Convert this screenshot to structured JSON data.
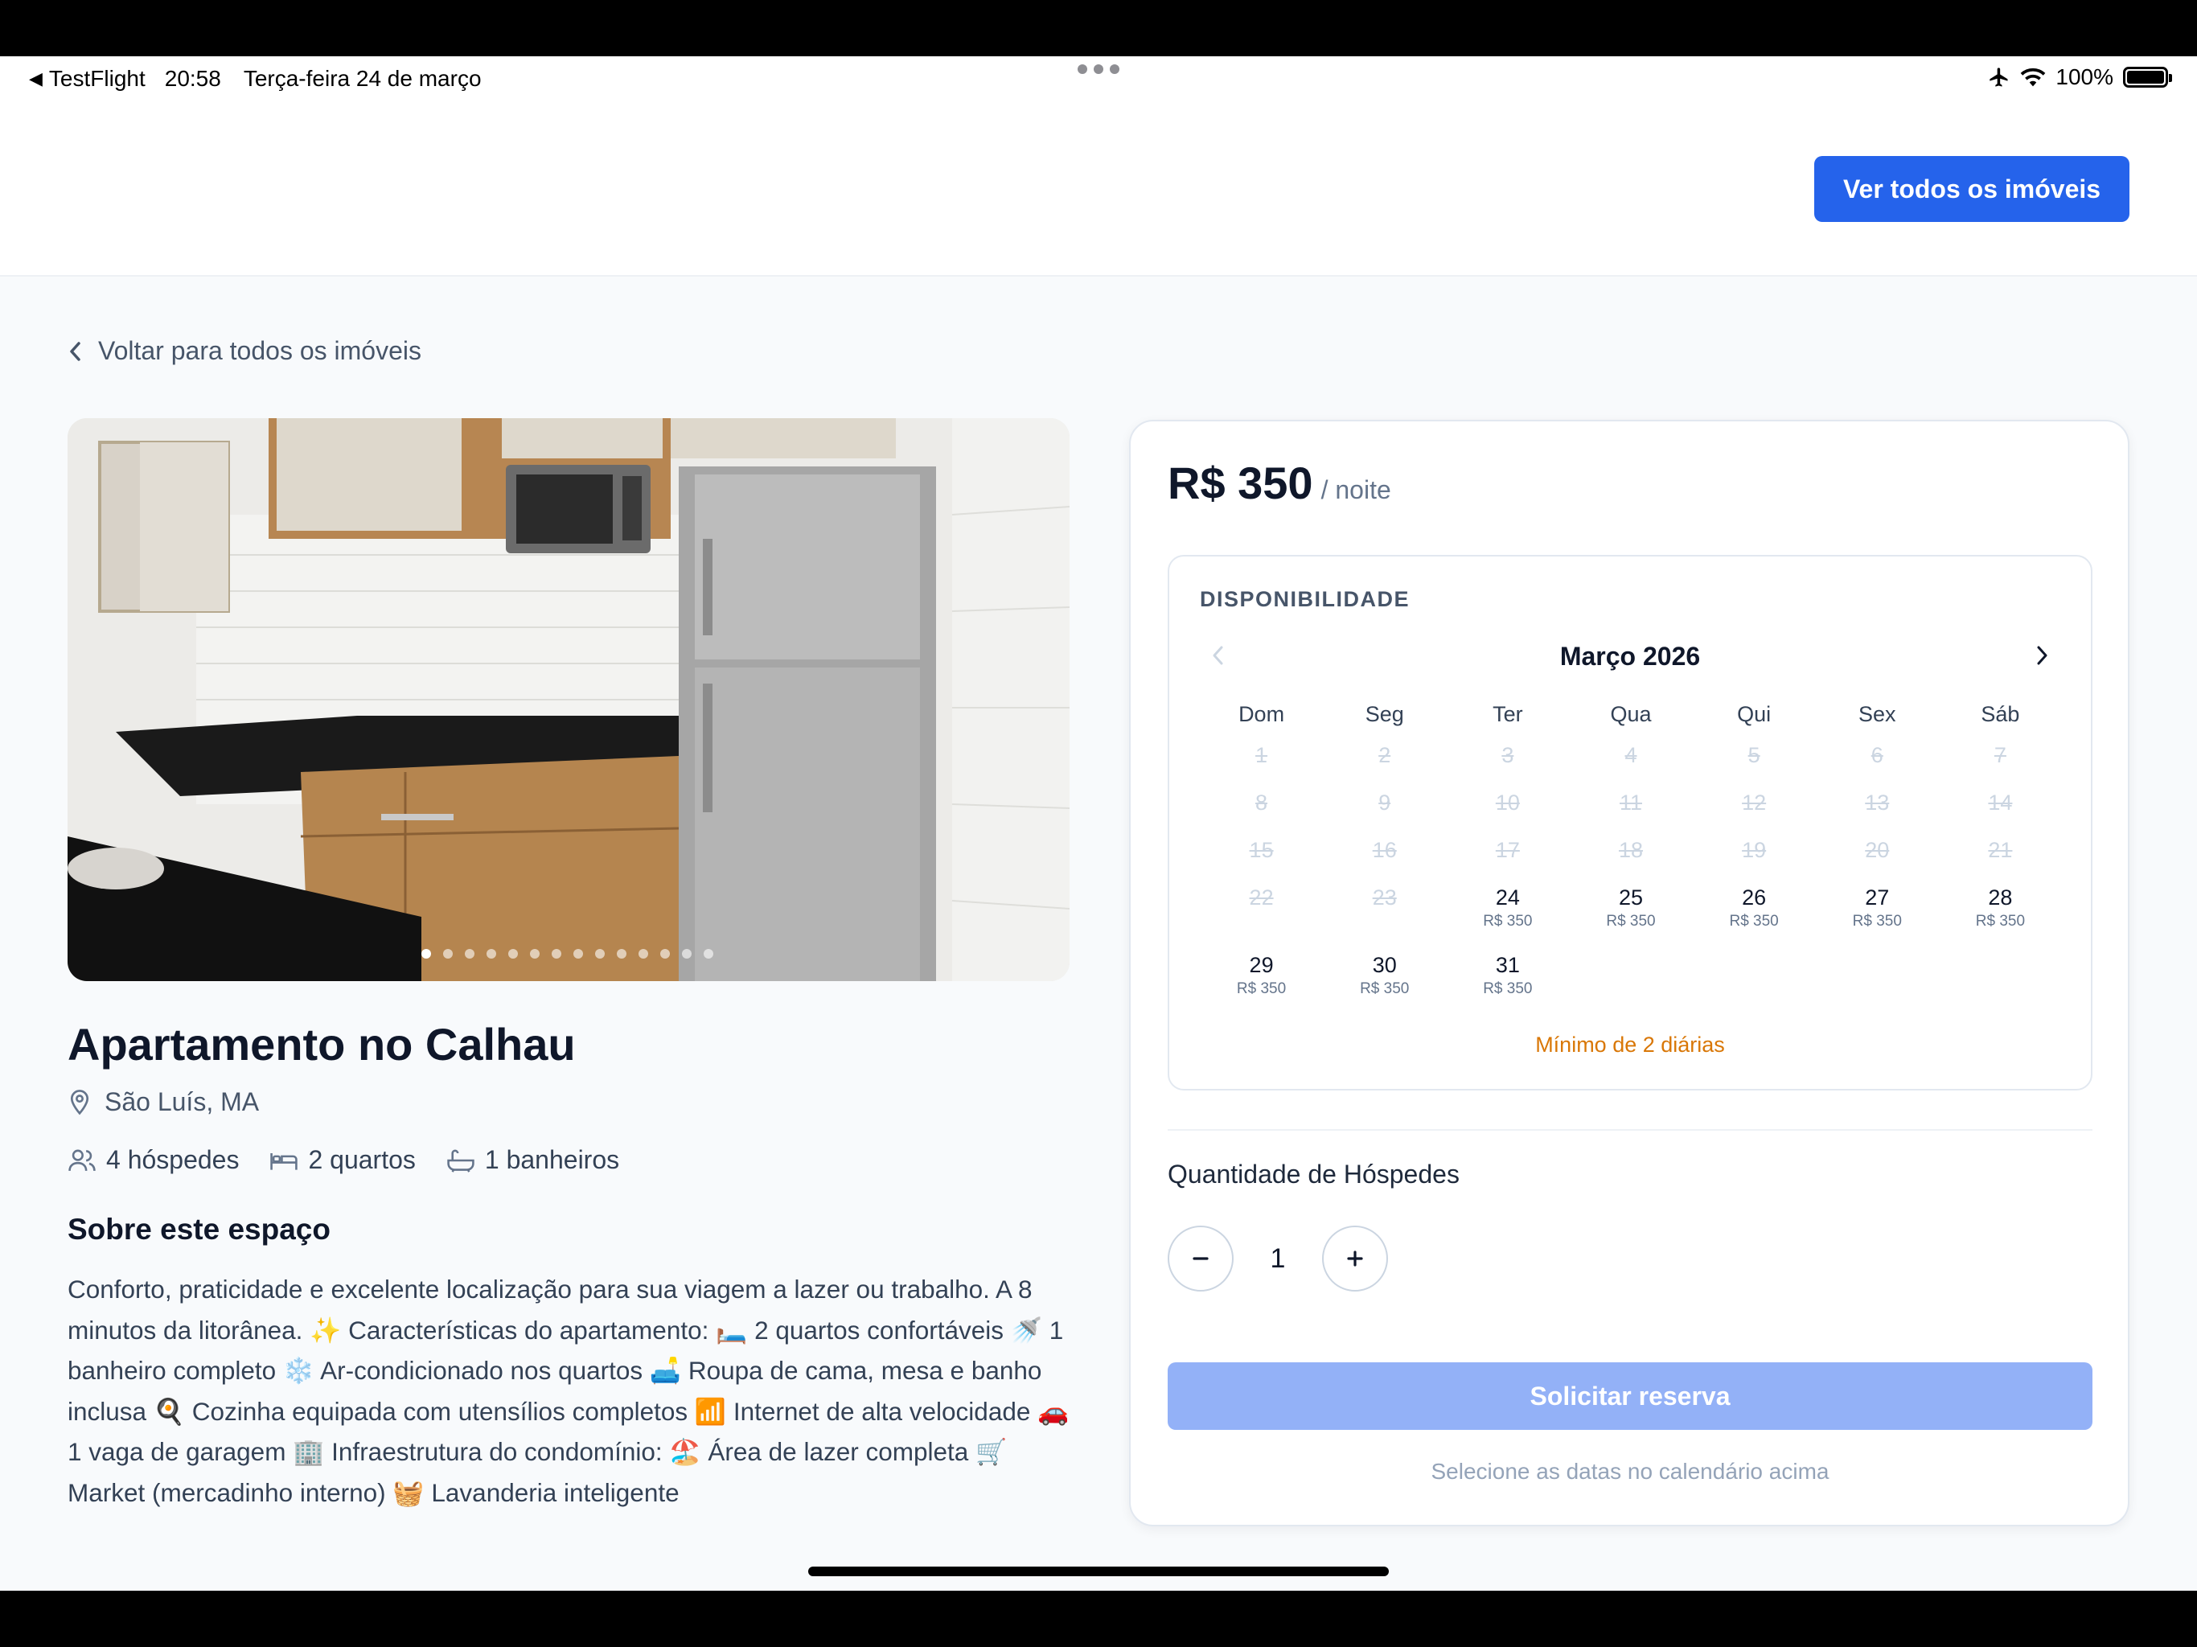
{
  "status_bar": {
    "back_app": "TestFlight",
    "time": "20:58",
    "date": "Terça-feira 24 de março",
    "battery": "100%"
  },
  "header": {
    "view_all_button": "Ver todos os imóveis"
  },
  "back_link": "Voltar para todos os imóveis",
  "gallery": {
    "photo_count": 14,
    "active_index": 0
  },
  "property": {
    "title": "Apartamento no Calhau",
    "location": "São Luís, MA",
    "guests": "4 hóspedes",
    "bedrooms": "2 quartos",
    "bathrooms": "1 banheiros",
    "about_title": "Sobre este espaço",
    "about_text": "Conforto, praticidade e excelente localização para sua viagem a lazer ou trabalho. A 8 minutos da litorânea. ✨ Características do apartamento: 🛏️ 2 quartos confortáveis 🚿 1 banheiro completo ❄️ Ar-condicionado nos quartos 🛋️ Roupa de cama, mesa e banho inclusa 🍳 Cozinha equipada com utensílios completos 📶 Internet de alta velocidade 🚗 1 vaga de garagem 🏢 Infraestrutura do condomínio: 🏖️ Área de lazer completa 🛒 Market (mercadinho interno) 🧺 Lavanderia inteligente"
  },
  "booking": {
    "price": "R$ 350",
    "per_night": "/ noite",
    "availability_label": "DISPONIBILIDADE",
    "month": "Março 2026",
    "weekdays": [
      "Dom",
      "Seg",
      "Ter",
      "Qua",
      "Qui",
      "Sex",
      "Sáb"
    ],
    "days": [
      {
        "n": "1",
        "state": "past"
      },
      {
        "n": "2",
        "state": "past"
      },
      {
        "n": "3",
        "state": "past"
      },
      {
        "n": "4",
        "state": "past"
      },
      {
        "n": "5",
        "state": "past"
      },
      {
        "n": "6",
        "state": "past"
      },
      {
        "n": "7",
        "state": "past"
      },
      {
        "n": "8",
        "state": "past"
      },
      {
        "n": "9",
        "state": "past"
      },
      {
        "n": "10",
        "state": "past"
      },
      {
        "n": "11",
        "state": "past"
      },
      {
        "n": "12",
        "state": "past"
      },
      {
        "n": "13",
        "state": "past"
      },
      {
        "n": "14",
        "state": "past"
      },
      {
        "n": "15",
        "state": "past"
      },
      {
        "n": "16",
        "state": "past"
      },
      {
        "n": "17",
        "state": "past"
      },
      {
        "n": "18",
        "state": "past"
      },
      {
        "n": "19",
        "state": "past"
      },
      {
        "n": "20",
        "state": "past"
      },
      {
        "n": "21",
        "state": "past"
      },
      {
        "n": "22",
        "state": "past"
      },
      {
        "n": "23",
        "state": "past"
      },
      {
        "n": "24",
        "state": "available",
        "price": "R$ 350"
      },
      {
        "n": "25",
        "state": "available",
        "price": "R$ 350"
      },
      {
        "n": "26",
        "state": "available",
        "price": "R$ 350"
      },
      {
        "n": "27",
        "state": "available",
        "price": "R$ 350"
      },
      {
        "n": "28",
        "state": "available",
        "price": "R$ 350"
      },
      {
        "n": "29",
        "state": "available",
        "price": "R$ 350"
      },
      {
        "n": "30",
        "state": "available",
        "price": "R$ 350"
      },
      {
        "n": "31",
        "state": "available",
        "price": "R$ 350"
      }
    ],
    "min_nights_note": "Mínimo de 2 diárias",
    "guests_label": "Quantidade de Hóspedes",
    "guest_count": "1",
    "reserve_button": "Solicitar reserva",
    "hint": "Selecione as datas no calendário acima"
  },
  "colors": {
    "primary": "#2563eb",
    "primary_disabled": "#93b1f7",
    "warning": "#d97706"
  }
}
